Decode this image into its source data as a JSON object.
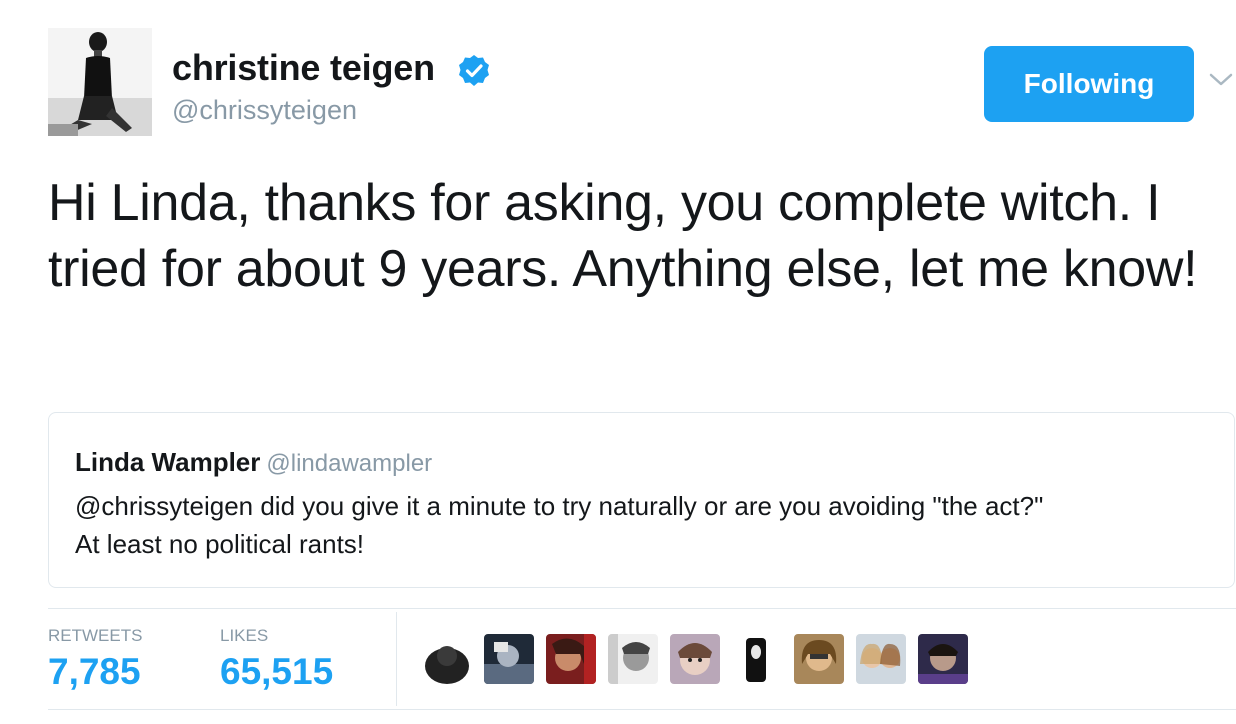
{
  "author": {
    "name": "christine teigen",
    "handle": "@chrissyteigen",
    "verified": true
  },
  "follow_button": {
    "label": "Following",
    "color": "#1da1f2"
  },
  "tweet": {
    "text": "Hi Linda, thanks for asking, you complete witch. I tried for about 9 years. Anything else, let me know!"
  },
  "quoted_tweet": {
    "name": "Linda Wampler",
    "handle": "@lindawampler",
    "text_line1": "@chrissyteigen did you give it a minute to try naturally or are you avoiding \"the act?\"",
    "text_line2": "At least no political rants!"
  },
  "stats": {
    "retweets_label": "RETWEETS",
    "retweets_value": "7,785",
    "likes_label": "LIKES",
    "likes_value": "65,515"
  },
  "likers": [
    {
      "name": "liker-avatar-1"
    },
    {
      "name": "liker-avatar-2"
    },
    {
      "name": "liker-avatar-3"
    },
    {
      "name": "liker-avatar-4"
    },
    {
      "name": "liker-avatar-5"
    },
    {
      "name": "liker-avatar-6"
    },
    {
      "name": "liker-avatar-7"
    },
    {
      "name": "liker-avatar-8"
    },
    {
      "name": "liker-avatar-9"
    }
  ],
  "colors": {
    "accent": "#1da1f2",
    "muted": "#8899a6",
    "border": "#e1e8ed"
  }
}
